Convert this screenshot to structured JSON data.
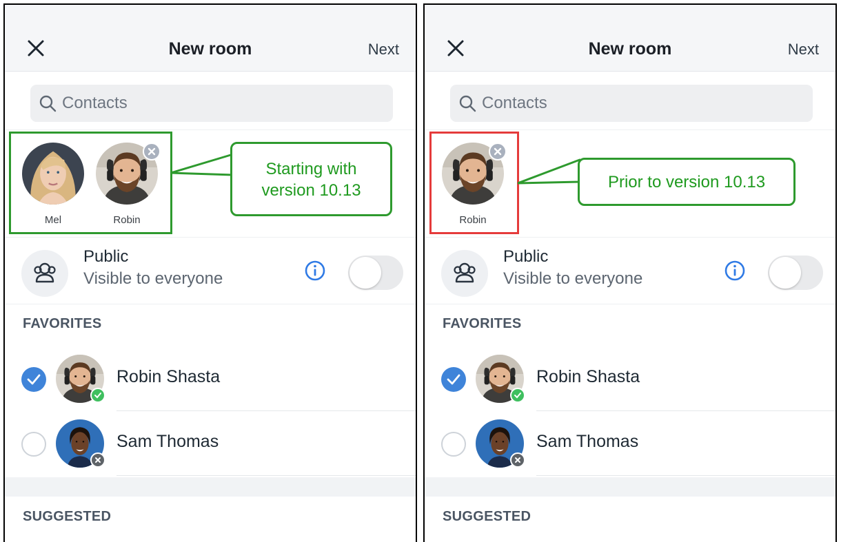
{
  "panels": [
    {
      "header": {
        "title": "New room",
        "next_label": "Next"
      },
      "search": {
        "placeholder": "Contacts"
      },
      "chips": [
        {
          "name": "Mel"
        },
        {
          "name": "Robin"
        }
      ],
      "public": {
        "title": "Public",
        "subtitle": "Visible to everyone",
        "toggle_on": false
      },
      "sections": {
        "favorites": "FAVORITES",
        "suggested": "SUGGESTED"
      },
      "contacts": [
        {
          "name": "Robin Shasta",
          "selected": true,
          "status": "available"
        },
        {
          "name": "Sam Thomas",
          "selected": false,
          "status": "offline"
        }
      ],
      "callout": {
        "line1": "Starting with",
        "line2": "version 10.13",
        "color": "#2e9a2e"
      }
    },
    {
      "header": {
        "title": "New room",
        "next_label": "Next"
      },
      "search": {
        "placeholder": "Contacts"
      },
      "chips": [
        {
          "name": "Robin"
        }
      ],
      "public": {
        "title": "Public",
        "subtitle": "Visible to everyone",
        "toggle_on": false
      },
      "sections": {
        "favorites": "FAVORITES",
        "suggested": "SUGGESTED"
      },
      "contacts": [
        {
          "name": "Robin Shasta",
          "selected": true,
          "status": "available"
        },
        {
          "name": "Sam Thomas",
          "selected": false,
          "status": "offline"
        }
      ],
      "callout": {
        "line1": "Prior to version 10.13",
        "color": "#e53b3b"
      }
    }
  ],
  "colors": {
    "accent": "#3f84d9",
    "available": "#3fbf5f",
    "offline": "#5e6368",
    "callout_text": "#1f9a1f"
  }
}
